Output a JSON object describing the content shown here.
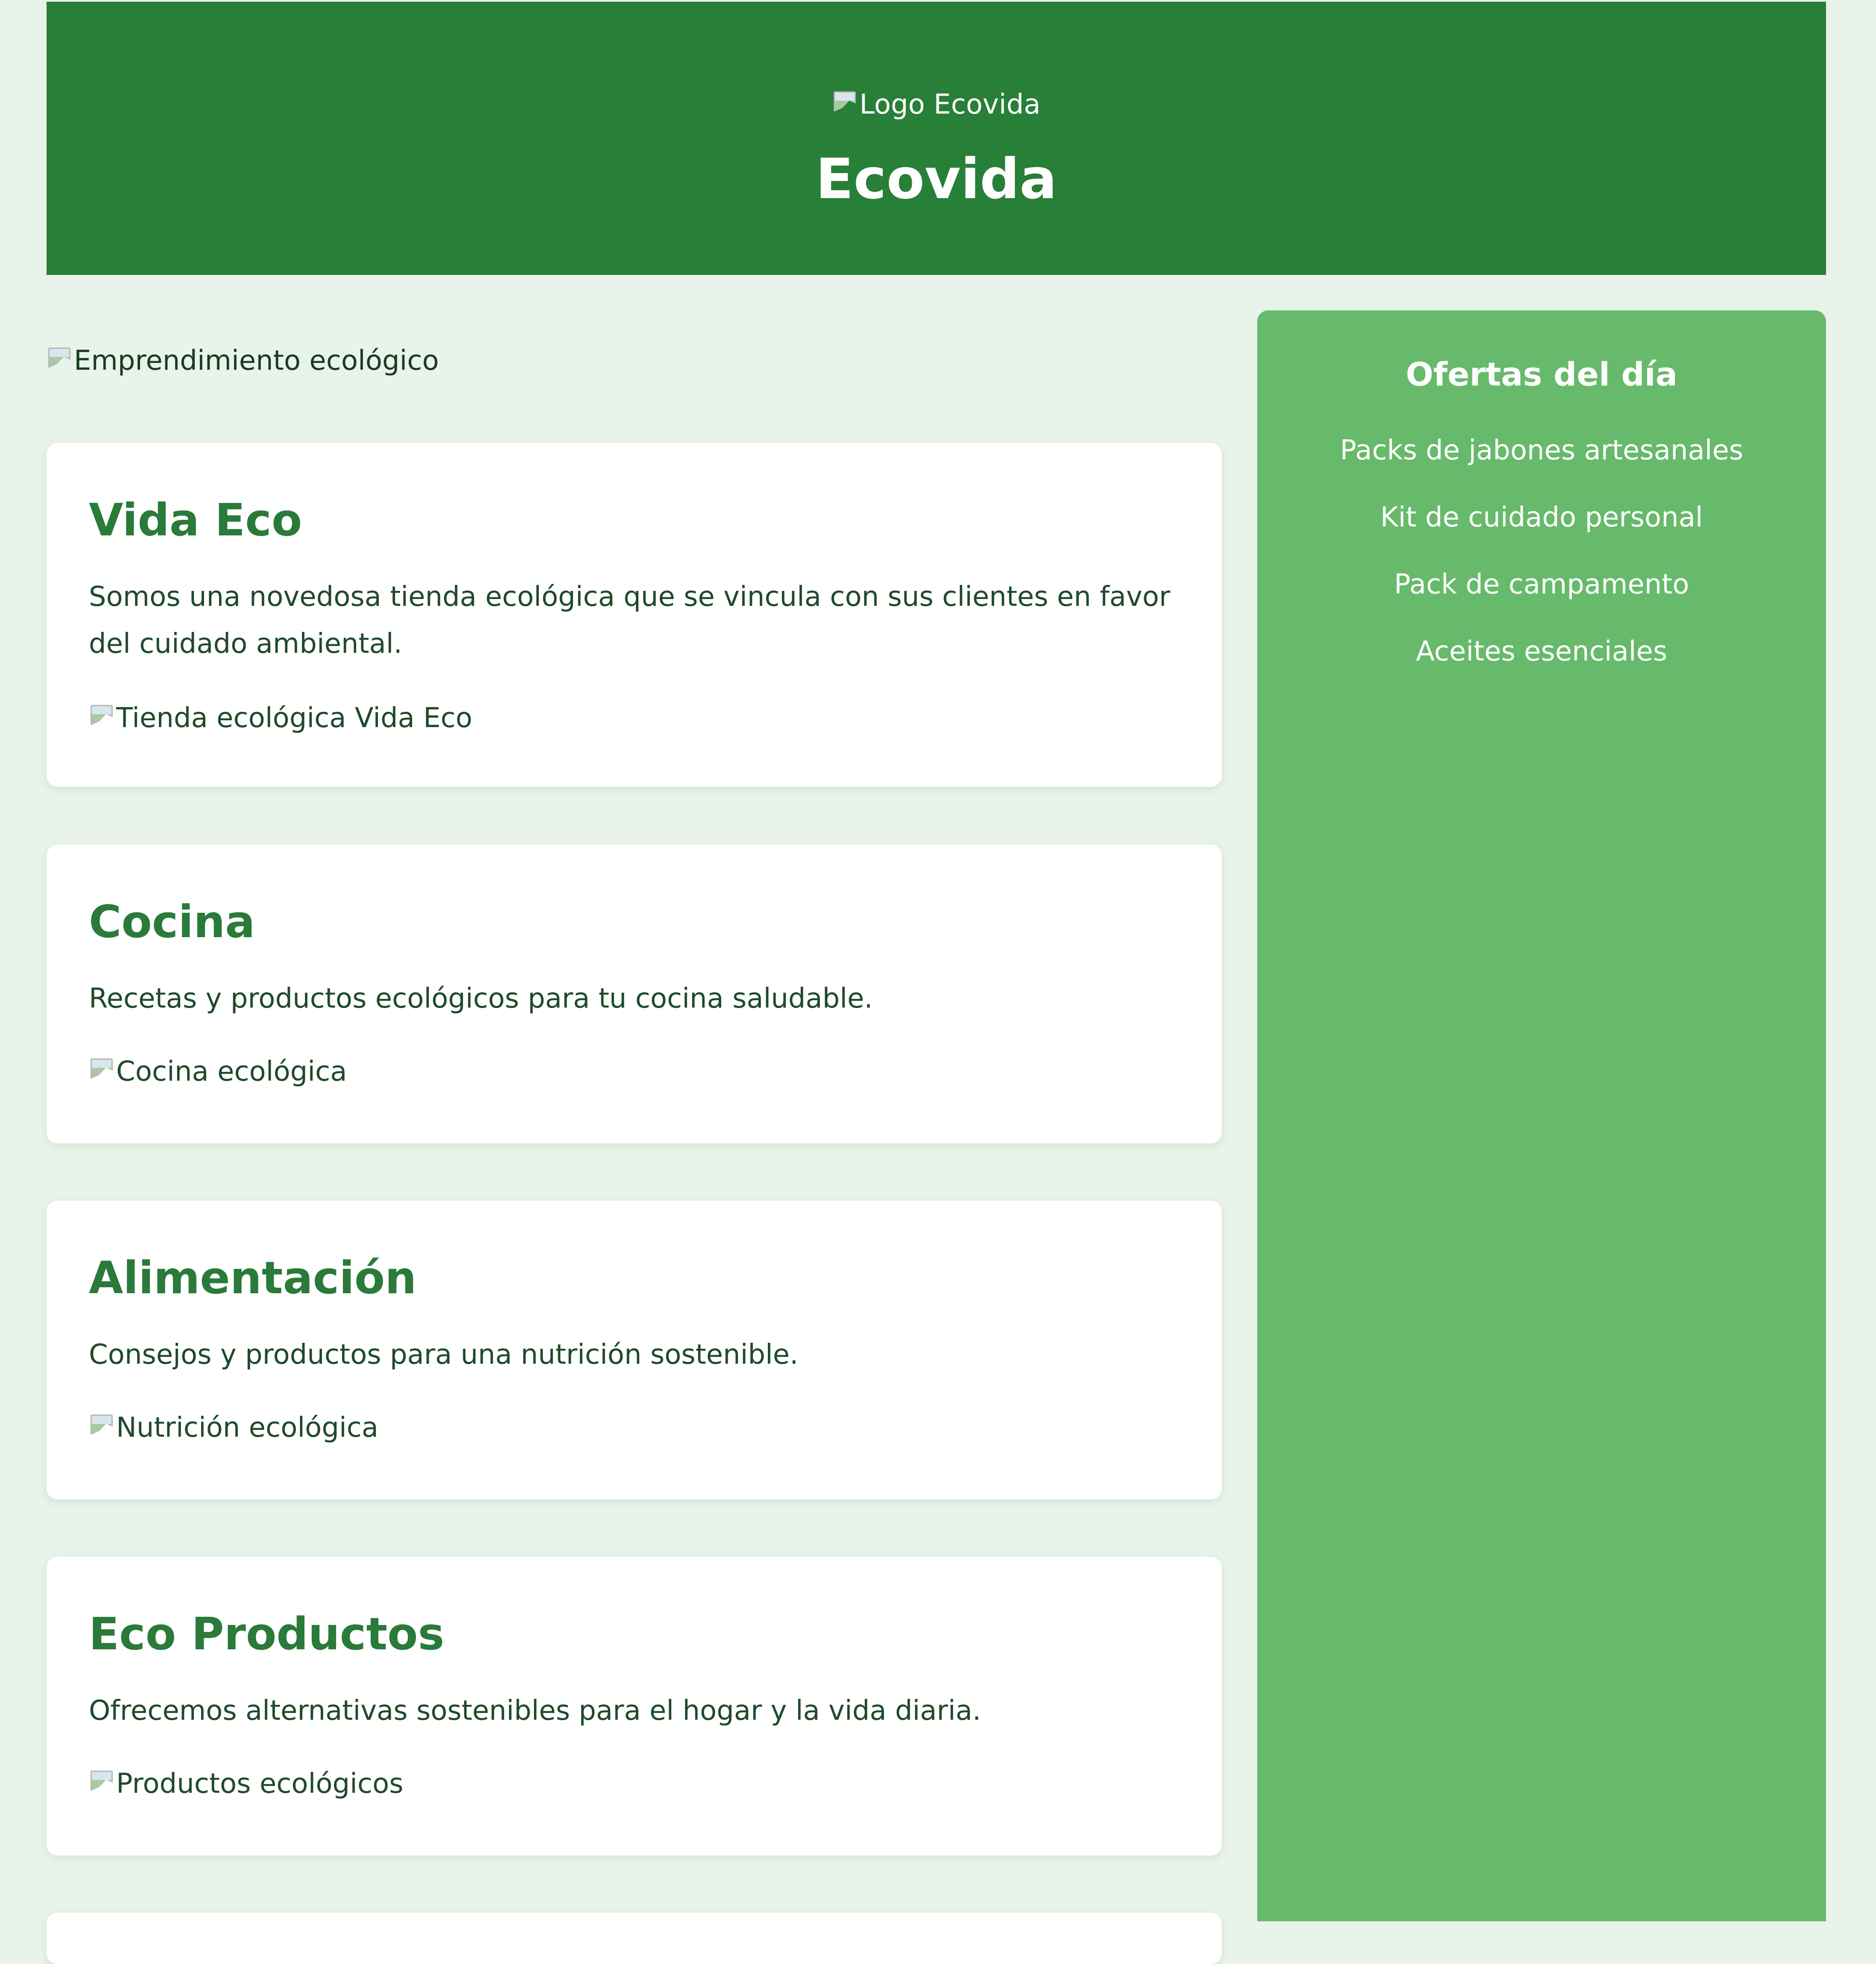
{
  "header": {
    "logo_alt": "Logo Ecovida",
    "title": "Ecovida"
  },
  "main": {
    "hero_alt": "Emprendimiento ecológico",
    "cards": [
      {
        "title": "Vida Eco",
        "text": "Somos una novedosa tienda ecológica que se vincula con sus clientes en favor del cuidado ambiental.",
        "img_alt": "Tienda ecológica Vida Eco"
      },
      {
        "title": "Cocina",
        "text": "Recetas y productos ecológicos para tu cocina saludable.",
        "img_alt": "Cocina ecológica"
      },
      {
        "title": "Alimentación",
        "text": "Consejos y productos para una nutrición sostenible.",
        "img_alt": "Nutrición ecológica"
      },
      {
        "title": "Eco Productos",
        "text": "Ofrecemos alternativas sostenibles para el hogar y la vida diaria.",
        "img_alt": "Productos ecológicos"
      }
    ]
  },
  "sidebar": {
    "title": "Ofertas del día",
    "offers": [
      "Packs de jabones artesanales",
      "Kit de cuidado personal",
      "Pack de campamento",
      "Aceites esenciales"
    ]
  },
  "colors": {
    "header_bg": "#287f38",
    "page_bg": "#e8f3e9",
    "sidebar_bg": "#67ba6b",
    "heading_green": "#2a7a39"
  },
  "icons": {
    "broken_image": "broken-image-icon"
  }
}
